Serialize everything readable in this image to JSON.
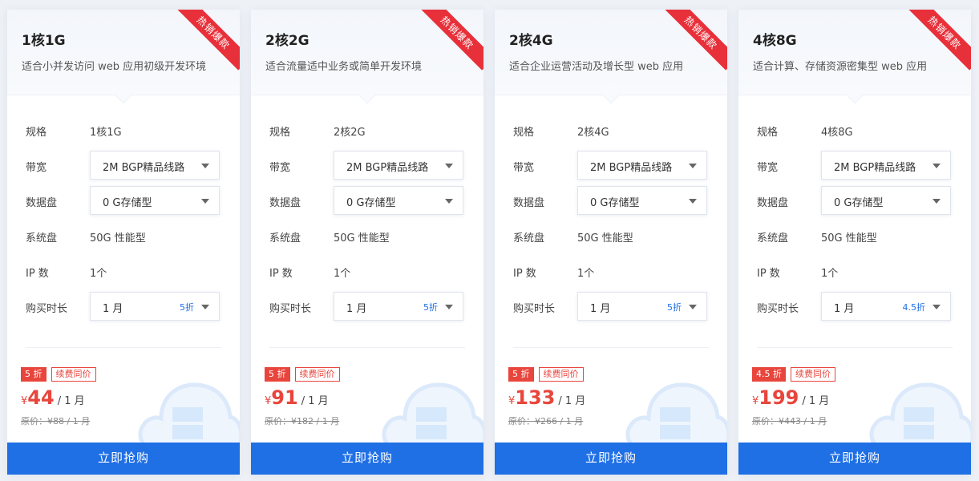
{
  "cards": [
    {
      "ribbon": "热销爆款",
      "title": "1核1G",
      "desc": "适合小并发访问 web 应用初级开发环境",
      "spec_label": "规格",
      "spec_value": "1核1G",
      "bandwidth_label": "带宽",
      "bandwidth_value": "2M BGP精品线路",
      "disk_label": "数据盘",
      "disk_value": "0 G存储型",
      "sysdisk_label": "系统盘",
      "sysdisk_value": "50G 性能型",
      "ip_label": "IP 数",
      "ip_value": "1个",
      "duration_label": "购买时长",
      "duration_value": "1 月",
      "duration_discount": "5折",
      "discount_badge": "5 折",
      "renew_badge": "续费同价",
      "currency": "¥",
      "price": "44",
      "unit": "/ 1 月",
      "original": "原价：¥88 / 1 月",
      "button": "立即抢购"
    },
    {
      "ribbon": "热销爆款",
      "title": "2核2G",
      "desc": "适合流量适中业务或简单开发环境",
      "spec_label": "规格",
      "spec_value": "2核2G",
      "bandwidth_label": "带宽",
      "bandwidth_value": "2M BGP精品线路",
      "disk_label": "数据盘",
      "disk_value": "0 G存储型",
      "sysdisk_label": "系统盘",
      "sysdisk_value": "50G 性能型",
      "ip_label": "IP 数",
      "ip_value": "1个",
      "duration_label": "购买时长",
      "duration_value": "1 月",
      "duration_discount": "5折",
      "discount_badge": "5 折",
      "renew_badge": "续费同价",
      "currency": "¥",
      "price": "91",
      "unit": "/ 1 月",
      "original": "原价：¥182 / 1 月",
      "button": "立即抢购"
    },
    {
      "ribbon": "热销爆款",
      "title": "2核4G",
      "desc": "适合企业运营活动及增长型 web 应用",
      "spec_label": "规格",
      "spec_value": "2核4G",
      "bandwidth_label": "带宽",
      "bandwidth_value": "2M BGP精品线路",
      "disk_label": "数据盘",
      "disk_value": "0 G存储型",
      "sysdisk_label": "系统盘",
      "sysdisk_value": "50G 性能型",
      "ip_label": "IP 数",
      "ip_value": "1个",
      "duration_label": "购买时长",
      "duration_value": "1 月",
      "duration_discount": "5折",
      "discount_badge": "5 折",
      "renew_badge": "续费同价",
      "currency": "¥",
      "price": "133",
      "unit": "/ 1 月",
      "original": "原价：¥266 / 1 月",
      "button": "立即抢购"
    },
    {
      "ribbon": "热销爆款",
      "title": "4核8G",
      "desc": "适合计算、存储资源密集型 web 应用",
      "spec_label": "规格",
      "spec_value": "4核8G",
      "bandwidth_label": "带宽",
      "bandwidth_value": "2M BGP精品线路",
      "disk_label": "数据盘",
      "disk_value": "0 G存储型",
      "sysdisk_label": "系统盘",
      "sysdisk_value": "50G 性能型",
      "ip_label": "IP 数",
      "ip_value": "1个",
      "duration_label": "购买时长",
      "duration_value": "1 月",
      "duration_discount": "4.5折",
      "discount_badge": "4.5 折",
      "renew_badge": "续费同价",
      "currency": "¥",
      "price": "199",
      "unit": "/ 1 月",
      "original": "原价：¥443 / 1 月",
      "button": "立即抢购"
    }
  ],
  "colors": {
    "accent": "#1f6fe5",
    "ribbon": "#e8303a",
    "price": "#e8453c",
    "background": "#eef1f6"
  }
}
